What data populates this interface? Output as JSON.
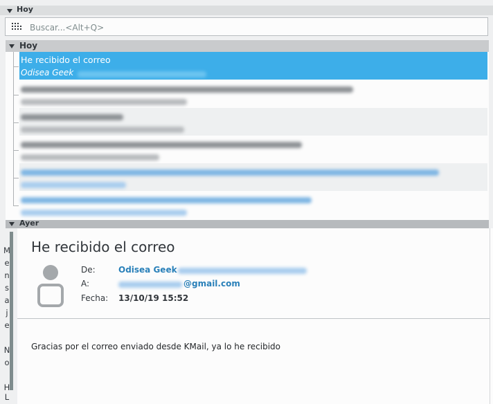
{
  "search": {
    "placeholder": "Buscar...<Alt+Q>"
  },
  "groups": {
    "today_ghost": "Hoy",
    "today": "Hoy",
    "yesterday": "Ayer"
  },
  "messages": {
    "selected": {
      "subject": "He recibido el correo",
      "from": "Odisea Geek"
    }
  },
  "reader": {
    "title": "He recibido el correo",
    "labels": {
      "from": "De:",
      "to": "A:",
      "date": "Fecha:"
    },
    "from_name": "Odisea Geek",
    "to_suffix": "@gmail.com",
    "date": "13/10/19 15:52",
    "body": "Gracias por el correo enviado desde KMail, ya lo he recibido"
  },
  "side_label": {
    "letters": [
      "M",
      "e",
      "n",
      "s",
      "a",
      "j",
      "e",
      "",
      "N",
      "o",
      "",
      "H",
      "L"
    ]
  },
  "colors": {
    "selection": "#3daee9",
    "link": "#2980b9"
  }
}
